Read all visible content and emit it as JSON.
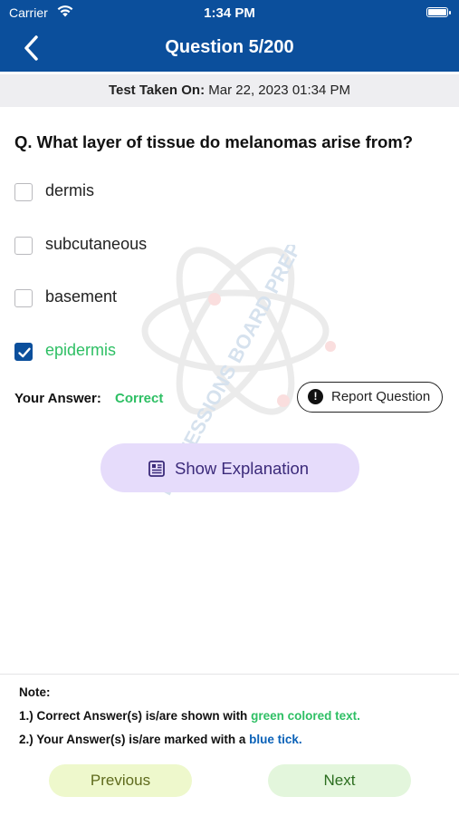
{
  "status_bar": {
    "carrier": "Carrier",
    "time": "1:34 PM"
  },
  "nav": {
    "title": "Question 5/200"
  },
  "test_info": {
    "label": "Test Taken On:",
    "value": "Mar 22, 2023 01:34 PM"
  },
  "question": {
    "text": "Q. What layer of tissue do melanomas arise from?",
    "options": [
      {
        "label": "dermis",
        "checked": false
      },
      {
        "label": "subcutaneous",
        "checked": false
      },
      {
        "label": "basement",
        "checked": false
      },
      {
        "label": "epidermis",
        "checked": true
      }
    ]
  },
  "answer": {
    "label": "Your Answer:",
    "value": "Correct"
  },
  "report_button": {
    "label": "Report Question"
  },
  "explanation_button": {
    "label": "Show Explanation"
  },
  "watermark": {
    "text": "PROFESSIONS BOARD PREP"
  },
  "notes": {
    "title": "Note:",
    "line1_prefix": "1.) Correct Answer(s) is/are shown with",
    "line1_highlight": "green colored text.",
    "line2_prefix": "2.) Your Answer(s) is/are marked with a",
    "line2_highlight": "blue tick."
  },
  "footer": {
    "previous_label": "Previous",
    "next_label": "Next"
  },
  "colors": {
    "header": "#0b4f9c",
    "correct_green": "#2ebf64",
    "tick_blue": "#0b62b8",
    "explain_bg": "#e6dcfb"
  }
}
